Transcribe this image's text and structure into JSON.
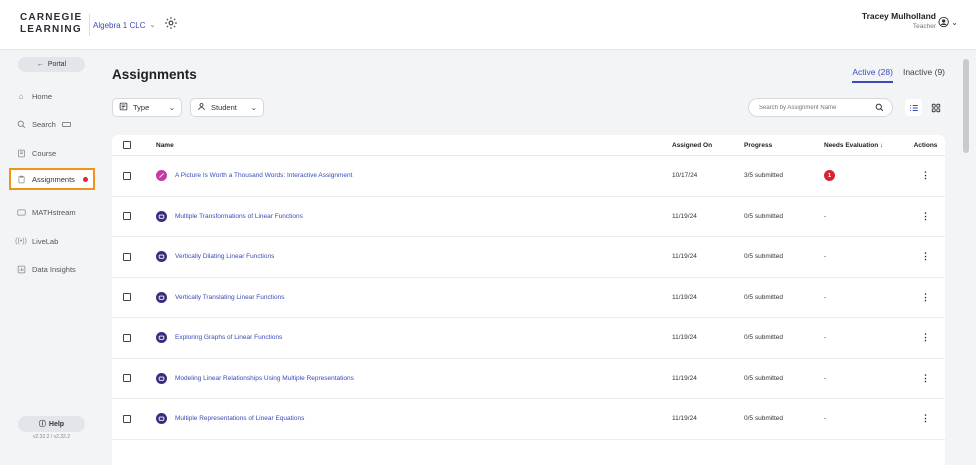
{
  "header": {
    "logo_line1": "CARNEGIE",
    "logo_line2": "LEARNING",
    "course": "Algebra 1 CLC",
    "user_name": "Tracey Mulholland",
    "user_role": "Teacher"
  },
  "sidebar": {
    "portal_label": "Portal",
    "items": [
      {
        "label": "Home",
        "icon": "home-icon"
      },
      {
        "label": "Search",
        "icon": "search-icon"
      },
      {
        "label": "Course",
        "icon": "course-icon"
      },
      {
        "label": "Assignments",
        "icon": "assignments-icon"
      },
      {
        "label": "MATHstream",
        "icon": "video-icon"
      },
      {
        "label": "LiveLab",
        "icon": "broadcast-icon"
      },
      {
        "label": "Data Insights",
        "icon": "chart-icon"
      }
    ],
    "help_label": "Help",
    "version": "v2.32.2 / v2.32.2"
  },
  "main": {
    "title": "Assignments",
    "tabs": [
      {
        "label": "Active (28)"
      },
      {
        "label": "Inactive (9)"
      }
    ],
    "filters": {
      "type_label": "Type",
      "student_label": "Student"
    },
    "search_placeholder": "Search by Assignment Name",
    "columns": {
      "name": "Name",
      "assigned_on": "Assigned On",
      "progress": "Progress",
      "needs_evaluation": "Needs Evaluation ↓",
      "actions": "Actions"
    },
    "rows": [
      {
        "name": "A Picture Is Worth a Thousand Words: Interactive Assignment",
        "assigned_on": "10/17/24",
        "progress": "3/5 submitted",
        "needs": "1"
      },
      {
        "name": "Multiple Transformations of Linear Functions",
        "assigned_on": "11/19/24",
        "progress": "0/5 submitted",
        "needs": "-"
      },
      {
        "name": "Vertically Dilating Linear Functions",
        "assigned_on": "11/19/24",
        "progress": "0/5 submitted",
        "needs": "-"
      },
      {
        "name": "Vertically Translating Linear Functions",
        "assigned_on": "11/19/24",
        "progress": "0/5 submitted",
        "needs": "-"
      },
      {
        "name": "Exploring Graphs of Linear Functions",
        "assigned_on": "11/19/24",
        "progress": "0/5 submitted",
        "needs": "-"
      },
      {
        "name": "Modeling Linear Relationships Using Multiple Representations",
        "assigned_on": "11/19/24",
        "progress": "0/5 submitted",
        "needs": "-"
      },
      {
        "name": "Multiple Representations of Linear Equations",
        "assigned_on": "11/19/24",
        "progress": "0/5 submitted",
        "needs": "-"
      }
    ]
  },
  "colors": {
    "accent": "#3b4cb8",
    "active_outline": "#f0931c",
    "alert": "#e0262f",
    "interactive_icon": "#c63aa6",
    "lesson_icon": "#3d2b7e"
  }
}
